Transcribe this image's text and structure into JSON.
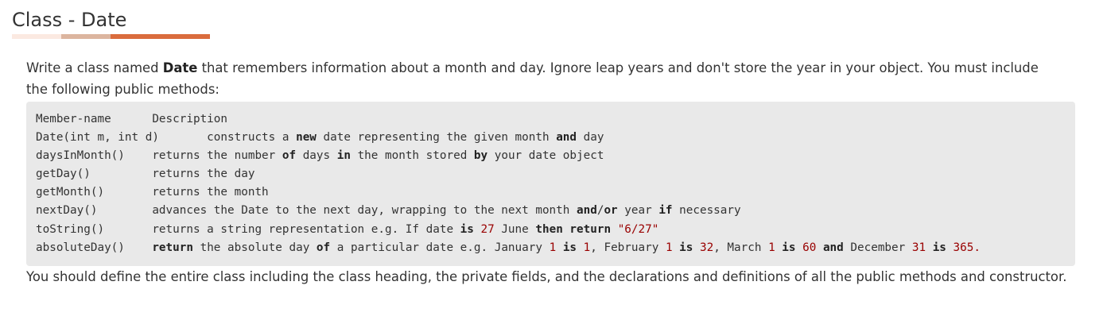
{
  "heading": {
    "title": "Class - Date"
  },
  "intro": {
    "before": "Write a class named ",
    "class_name": "Date",
    "after": " that remembers information about a month and day. Ignore leap years and don't store the year in your object. You must include the following public methods:"
  },
  "methods_table": {
    "header": "Member-name      Description",
    "lines": [
      [
        {
          "t": "Date(int m, int d)       constructs a ",
          "k": "plain"
        },
        {
          "t": "new",
          "k": "kw"
        },
        {
          "t": " date representing the given month ",
          "k": "plain"
        },
        {
          "t": "and",
          "k": "kw"
        },
        {
          "t": " day",
          "k": "plain"
        }
      ],
      [
        {
          "t": "daysInMonth()    returns the number ",
          "k": "plain"
        },
        {
          "t": "of",
          "k": "kw"
        },
        {
          "t": " days ",
          "k": "plain"
        },
        {
          "t": "in",
          "k": "kw"
        },
        {
          "t": " the month stored ",
          "k": "plain"
        },
        {
          "t": "by",
          "k": "kw"
        },
        {
          "t": " your date object",
          "k": "plain"
        }
      ],
      [
        {
          "t": "getDay()         returns the day",
          "k": "plain"
        }
      ],
      [
        {
          "t": "getMonth()       returns the month",
          "k": "plain"
        }
      ],
      [
        {
          "t": "nextDay()        advances the Date to the next day, wrapping to the next month ",
          "k": "plain"
        },
        {
          "t": "and",
          "k": "kw"
        },
        {
          "t": "/",
          "k": "plain"
        },
        {
          "t": "or",
          "k": "kw"
        },
        {
          "t": " year ",
          "k": "plain"
        },
        {
          "t": "if",
          "k": "kw"
        },
        {
          "t": " necessary",
          "k": "plain"
        }
      ],
      [
        {
          "t": "toString()       returns a string representation e.g. If date ",
          "k": "plain"
        },
        {
          "t": "is",
          "k": "kw"
        },
        {
          "t": " ",
          "k": "plain"
        },
        {
          "t": "27",
          "k": "num"
        },
        {
          "t": " June ",
          "k": "plain"
        },
        {
          "t": "then",
          "k": "kw"
        },
        {
          "t": " ",
          "k": "plain"
        },
        {
          "t": "return",
          "k": "kw"
        },
        {
          "t": " ",
          "k": "plain"
        },
        {
          "t": "\"6/27\"",
          "k": "str"
        }
      ],
      [
        {
          "t": "absoluteDay()    ",
          "k": "plain"
        },
        {
          "t": "return",
          "k": "kw"
        },
        {
          "t": " the absolute day ",
          "k": "plain"
        },
        {
          "t": "of",
          "k": "kw"
        },
        {
          "t": " a particular date e.g. January ",
          "k": "plain"
        },
        {
          "t": "1",
          "k": "num"
        },
        {
          "t": " ",
          "k": "plain"
        },
        {
          "t": "is",
          "k": "kw"
        },
        {
          "t": " ",
          "k": "plain"
        },
        {
          "t": "1",
          "k": "num"
        },
        {
          "t": ", February ",
          "k": "plain"
        },
        {
          "t": "1",
          "k": "num"
        },
        {
          "t": " ",
          "k": "plain"
        },
        {
          "t": "is",
          "k": "kw"
        },
        {
          "t": " ",
          "k": "plain"
        },
        {
          "t": "32",
          "k": "num"
        },
        {
          "t": ", March ",
          "k": "plain"
        },
        {
          "t": "1",
          "k": "num"
        },
        {
          "t": " ",
          "k": "plain"
        },
        {
          "t": "is",
          "k": "kw"
        },
        {
          "t": " ",
          "k": "plain"
        },
        {
          "t": "60",
          "k": "num"
        },
        {
          "t": " ",
          "k": "plain"
        },
        {
          "t": "and",
          "k": "kw"
        },
        {
          "t": " December ",
          "k": "plain"
        },
        {
          "t": "31",
          "k": "num"
        },
        {
          "t": " ",
          "k": "plain"
        },
        {
          "t": "is",
          "k": "kw"
        },
        {
          "t": " ",
          "k": "plain"
        },
        {
          "t": "365.",
          "k": "num"
        }
      ]
    ]
  },
  "outro": {
    "text": "You should define the entire class including the class heading, the private fields, and the declarations and definitions of all the public methods and constructor."
  },
  "colors": {
    "accent_dark": "#da6c3d",
    "accent_mid": "#dcb59f",
    "accent_light": "#fbe9e1",
    "code_background": "#e9e9e9",
    "number_literal": "#990000"
  }
}
